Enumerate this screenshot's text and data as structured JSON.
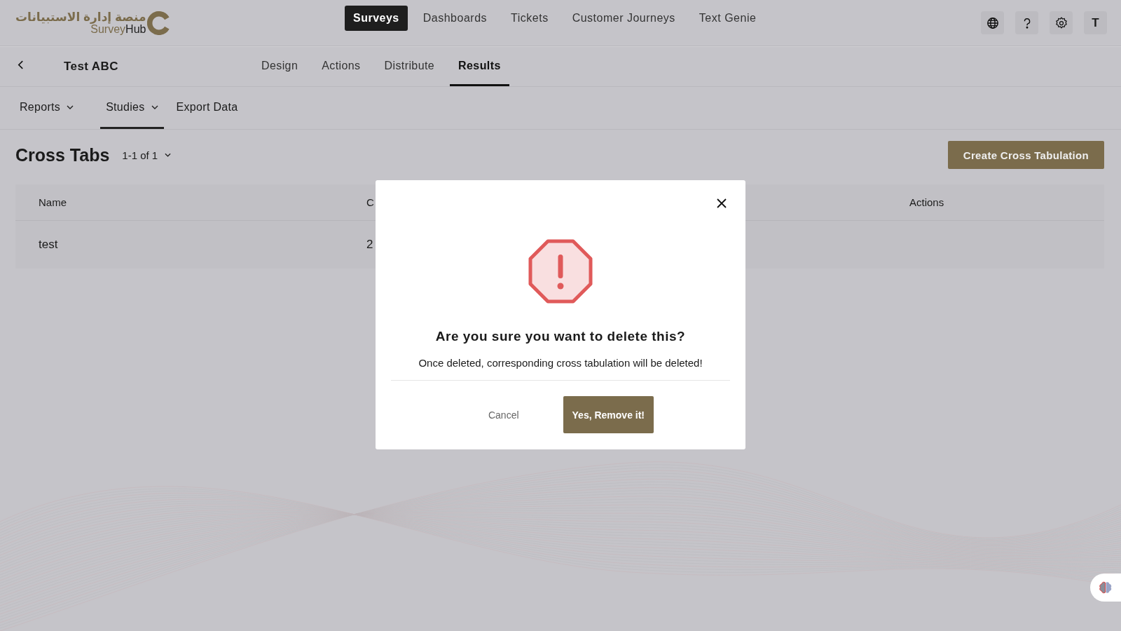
{
  "logo": {
    "arabic": "منصة إدارة الاستبيانات",
    "name_part1": "Survey",
    "name_part2": "Hub"
  },
  "main_nav": [
    {
      "label": "Surveys",
      "selected": true
    },
    {
      "label": "Dashboards",
      "selected": false
    },
    {
      "label": "Tickets",
      "selected": false
    },
    {
      "label": "Customer Journeys",
      "selected": false
    },
    {
      "label": "Text Genie",
      "selected": false
    }
  ],
  "user_avatar": "T",
  "survey": {
    "title": "Test ABC",
    "tabs": [
      {
        "label": "Design",
        "selected": false
      },
      {
        "label": "Actions",
        "selected": false
      },
      {
        "label": "Distribute",
        "selected": false
      },
      {
        "label": "Results",
        "selected": true
      }
    ]
  },
  "sub_tabs": [
    {
      "label": "Reports",
      "dropdown": true,
      "selected": false
    },
    {
      "label": "Studies",
      "dropdown": true,
      "selected": true
    },
    {
      "label": "Export Data",
      "dropdown": false,
      "selected": false
    }
  ],
  "page": {
    "title": "Cross Tabs",
    "pagination": "1-1 of 1",
    "create_button": "Create Cross Tabulation"
  },
  "table": {
    "columns": [
      "Name",
      "C",
      "Actions"
    ],
    "rows": [
      [
        "test",
        "2",
        ""
      ]
    ]
  },
  "dialog": {
    "title": "Are you sure you want to delete this?",
    "message": "Once deleted, corresponding cross tabulation will be deleted!",
    "cancel": "Cancel",
    "confirm": "Yes, Remove it!"
  }
}
